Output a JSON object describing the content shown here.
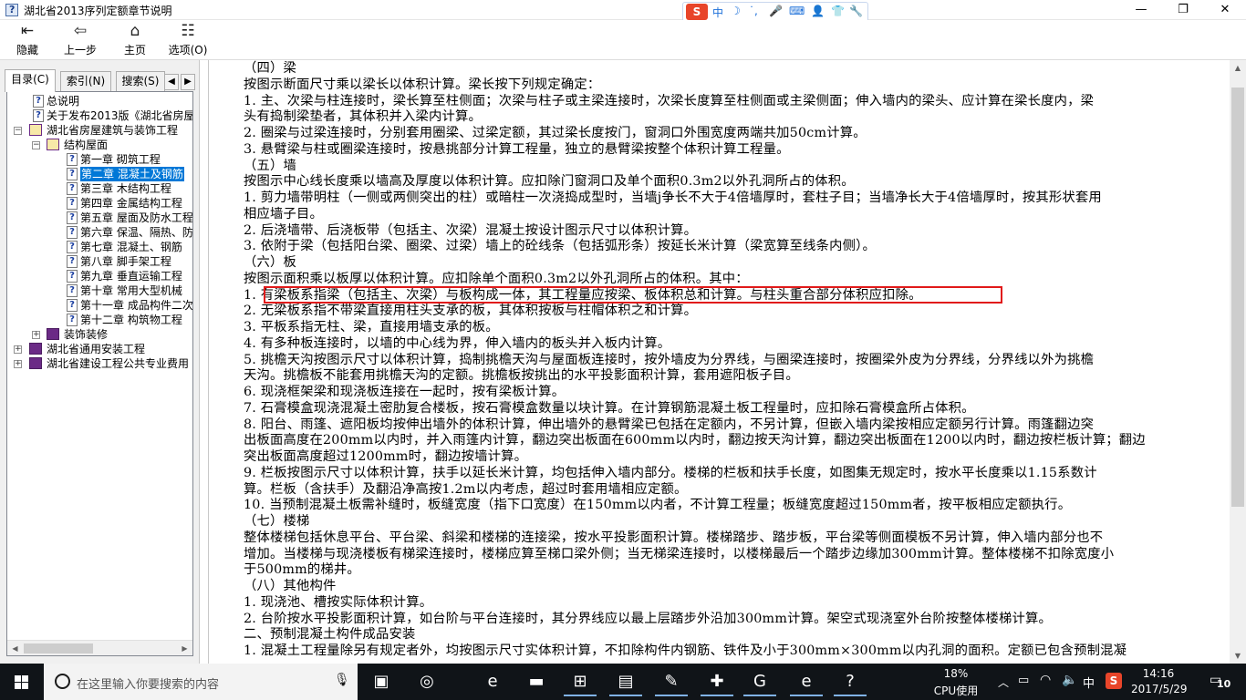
{
  "window": {
    "title": "湖北省2013序列定额章节说明",
    "minimize": "—",
    "maximize": "❐",
    "close": "✕"
  },
  "ime": {
    "logo": "S",
    "items": [
      "中",
      "☽",
      "˙,",
      "🎤",
      "⌨",
      "👤",
      "👕",
      "🔧"
    ]
  },
  "toolbar": {
    "buttons": [
      {
        "label": "隐藏",
        "icon": "hide-icon",
        "glyph": "⇤"
      },
      {
        "label": "上一步",
        "icon": "back-arrow-icon",
        "glyph": "⇦"
      },
      {
        "label": "主页",
        "icon": "home-icon",
        "glyph": "⌂"
      },
      {
        "label": "选项(O)",
        "icon": "options-icon",
        "glyph": "☷"
      }
    ]
  },
  "tabs": [
    {
      "label": "目录(C)",
      "active": true
    },
    {
      "label": "索引(N)",
      "active": false
    },
    {
      "label": "搜索(S)",
      "active": false
    }
  ],
  "tree": [
    {
      "label": "总说明",
      "type": "doc",
      "level": 0
    },
    {
      "label": "关于发布2013版《湖北省房屋",
      "type": "doc",
      "level": 0
    },
    {
      "label": "湖北省房屋建筑与装饰工程",
      "type": "book-open",
      "level": 0,
      "expander": "−"
    },
    {
      "label": "结构屋面",
      "type": "book-open",
      "level": 1,
      "expander": "−"
    },
    {
      "label": "第一章  砌筑工程",
      "type": "doc",
      "level": 2
    },
    {
      "label": "第二章  混凝土及钢筋",
      "type": "doc",
      "level": 2,
      "selected": true
    },
    {
      "label": "第三章  木结构工程",
      "type": "doc",
      "level": 2
    },
    {
      "label": "第四章  金属结构工程",
      "type": "doc",
      "level": 2
    },
    {
      "label": "第五章  屋面及防水工程",
      "type": "doc",
      "level": 2
    },
    {
      "label": "第六章  保温、隔热、防",
      "type": "doc",
      "level": 2
    },
    {
      "label": "第七章  混凝土、钢筋",
      "type": "doc",
      "level": 2
    },
    {
      "label": "第八章  脚手架工程",
      "type": "doc",
      "level": 2
    },
    {
      "label": "第九章  垂直运输工程",
      "type": "doc",
      "level": 2
    },
    {
      "label": "第十章  常用大型机械",
      "type": "doc",
      "level": 2
    },
    {
      "label": "第十一章  成品构件二次",
      "type": "doc",
      "level": 2
    },
    {
      "label": "第十二章  构筑物工程",
      "type": "doc",
      "level": 2
    },
    {
      "label": "装饰装修",
      "type": "book-closed",
      "level": 1,
      "expander": "+"
    },
    {
      "label": "湖北省通用安装工程",
      "type": "book-closed",
      "level": 0,
      "expander": "+"
    },
    {
      "label": "湖北省建设工程公共专业费用",
      "type": "book-closed",
      "level": 0,
      "expander": "+"
    }
  ],
  "content": {
    "lines": [
      "（四）梁",
      "按图示断面尺寸乘以梁长以体积计算。梁长按下列规定确定：",
      "1. 主、次梁与柱连接时，梁长算至柱侧面；次梁与柱子或主梁连接时，次梁长度算至柱侧面或主梁侧面；伸入墙内的梁头、应计算在梁长度内，梁",
      "头有捣制梁垫者，其体积并入梁内计算。",
      "2. 圈梁与过梁连接时，分别套用圈梁、过梁定额，其过梁长度按门，窗洞口外围宽度两端共加50cm计算。",
      "3. 悬臂梁与柱或圈梁连接时，按悬挑部分计算工程量，独立的悬臂梁按整个体积计算工程量。",
      "（五）墙",
      "按图示中心线长度乘以墙高及厚度以体积计算。应扣除门窗洞口及单个面积0.3m2以外孔洞所占的体积。",
      "1. 剪力墙带明柱（一侧或两侧突出的柱）或暗柱一次浇捣成型时，当墙j争长不大于4倍墙厚时，套柱子目；当墙净长大于4倍墙厚时，按其形状套用",
      "相应墙子目。",
      "2. 后浇墙带、后浇板带（包括主、次梁）混凝土按设计图示尺寸以体积计算。",
      "3. 依附于梁（包括阳台梁、圈梁、过梁）墙上的砼线条（包括弧形条）按延长米计算（梁宽算至线条内侧）。",
      "（六）板",
      "按图示面积乘以板厚以体积计算。应扣除单个面积0.3m2以外孔洞所占的体积。其中：",
      "1. 有梁板系指梁（包括主、次梁）与板构成一体，其工程量应按梁、板体积总和计算。与柱头重合部分体积应扣除。",
      "2. 无梁板系指不带梁直接用柱头支承的板，其体积按板与柱帽体积之和计算。",
      "3. 平板系指无柱、梁，直接用墙支承的板。",
      "4. 有多种板连接时，以墙的中心线为界，伸入墙内的板头并入板内计算。",
      "5. 挑檐天沟按图示尺寸以体积计算，捣制挑檐天沟与屋面板连接时，按外墙皮为分界线，与圈梁连接时，按圈梁外皮为分界线，分界线以外为挑檐",
      "天沟。挑檐板不能套用挑檐天沟的定额。挑檐板按挑出的水平投影面积计算，套用遮阳板子目。",
      "6. 现浇框架梁和现浇板连接在一起时，按有梁板计算。",
      "7. 石膏模盒现浇混凝土密肋复合楼板，按石膏模盒数量以块计算。在计算钢筋混凝土板工程量时，应扣除石膏模盒所占体积。",
      "8. 阳台、雨篷、遮阳板均按伸出墙外的体积计算，伸出墙外的悬臂梁已包括在定额内，不另计算，但嵌入墙内梁按相应定额另行计算。雨篷翻边突",
      "出板面高度在200mm以内时，并入雨篷内计算，翻边突出板面在600mm以内时，翻边按天沟计算，翻边突出板面在1200以内时，翻边按栏板计算；翻边",
      "突出板面高度超过1200mm时，翻边按墙计算。",
      "9. 栏板按图示尺寸以体积计算，扶手以延长米计算，均包括伸入墙内部分。楼梯的栏板和扶手长度，如图集无规定时，按水平长度乘以1.15系数计",
      "算。栏板（含扶手）及翻沿净高按1.2m以内考虑，超过时套用墙相应定额。",
      "10. 当预制混凝土板需补缝时，板缝宽度（指下口宽度）在150mm以内者，不计算工程量；板缝宽度超过150mm者，按平板相应定额执行。",
      "（七）楼梯",
      "整体楼梯包括休息平台、平台梁、斜梁和楼梯的连接梁，按水平投影面积计算。楼梯踏步、踏步板，平台梁等侧面模板不另计算，伸入墙内部分也不",
      "增加。当楼梯与现浇楼板有梯梁连接时，楼梯应算至梯口梁外侧；当无梯梁连接时，以楼梯最后一个踏步边缘加300mm计算。整体楼梯不扣除宽度小",
      "于500mm的梯井。",
      "（八）其他构件",
      "1. 现浇池、槽按实际体积计算。",
      "2. 台阶按水平投影面积计算，如台阶与平台连接时，其分界线应以最上层踏步外沿加300mm计算。架空式现浇室外台阶按整体楼梯计算。",
      "二、预制混凝土构件成品安装",
      "1. 混凝土工程量除另有规定者外，均按图示尺寸实体积计算，不扣除构件内钢筋、铁件及小于300mm×300mm以内孔洞的面积。定额已包含预制混凝"
    ],
    "highlighted_line": 14
  },
  "taskbar": {
    "search_placeholder": "在这里输入你要搜索的内容",
    "apps": [
      {
        "name": "task-view-icon",
        "glyph": "▣"
      },
      {
        "name": "sogou-browser-icon",
        "glyph": "◎"
      },
      {
        "name": "edge-icon",
        "glyph": "e"
      },
      {
        "name": "file-explorer-icon",
        "glyph": "▬"
      },
      {
        "name": "store-icon",
        "glyph": "⊞"
      },
      {
        "name": "calendar-app-icon",
        "glyph": "▤"
      },
      {
        "name": "notes-app-icon",
        "glyph": "✎"
      },
      {
        "name": "add-app-icon",
        "glyph": "✚"
      },
      {
        "name": "sogou-icon",
        "glyph": "G"
      },
      {
        "name": "ie-icon",
        "glyph": "e"
      },
      {
        "name": "help-file-icon",
        "glyph": "?"
      }
    ],
    "cpu_percent": "18%",
    "cpu_label": "CPU使用",
    "ime_label": "中",
    "time": "14:16",
    "date": "2017/5/29",
    "notification_count": "10"
  }
}
